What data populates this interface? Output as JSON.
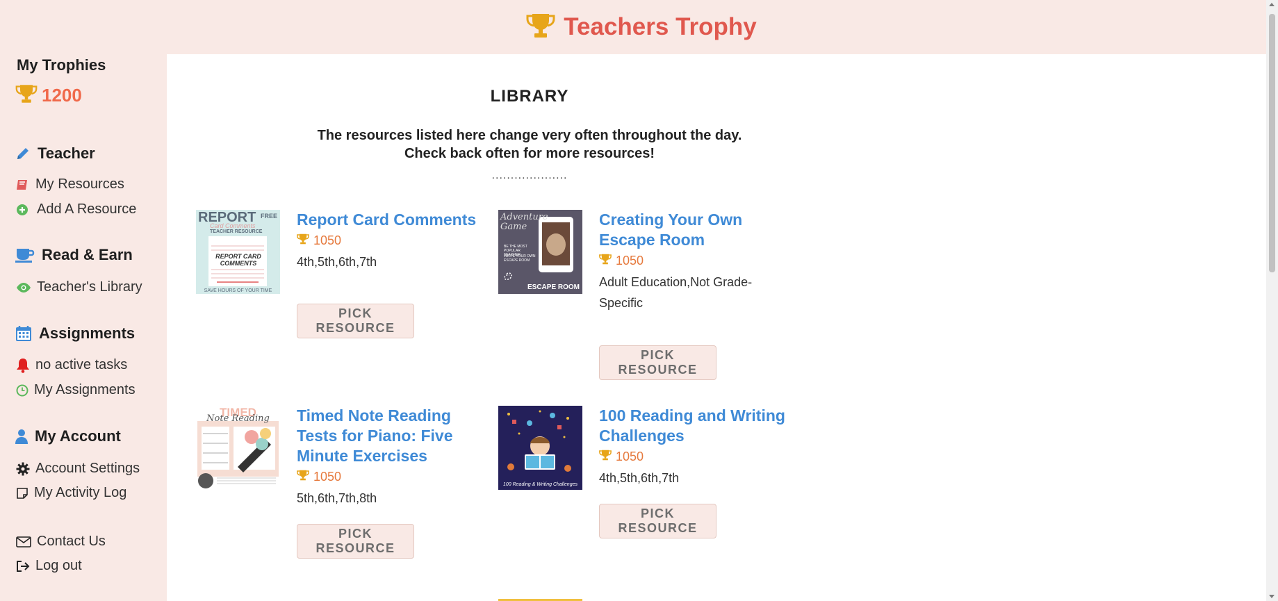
{
  "header": {
    "title": "Teachers Trophy"
  },
  "sidebar": {
    "trophies_heading": "My Trophies",
    "trophies_count": "1200",
    "teacher": {
      "heading": "Teacher",
      "my_resources": "My Resources",
      "add_resource": "Add A Resource"
    },
    "read_earn": {
      "heading": "Read & Earn",
      "library": "Teacher's Library"
    },
    "assignments": {
      "heading": "Assignments",
      "no_tasks": "no active tasks",
      "my_assignments": "My Assignments"
    },
    "account": {
      "heading": "My Account",
      "settings": "Account Settings",
      "activity_log": "My Activity Log"
    },
    "contact": "Contact Us",
    "logout": "Log out"
  },
  "library": {
    "title": "LIBRARY",
    "desc_line1": "The resources listed here change very often throughout the day.",
    "desc_line2": "Check back often for more resources!",
    "dots": "....................",
    "pick_label": "PICK RESOURCE",
    "resources": [
      {
        "title": "Report Card Comments",
        "price": "1050",
        "grades": "4th,5th,6th,7th",
        "thumb_text": {
          "top": "REPORT",
          "sub": "Card Comments",
          "badge": "FREE",
          "kind": "TEACHER RESOURCE",
          "handwritten": "REPORT CARD COMMENTS",
          "footer": "SAVE HOURS OF YOUR TIME"
        }
      },
      {
        "title": "Creating Your Own Escape Room",
        "price": "1050",
        "grades": "Adult Education,Not Grade-Specific",
        "thumb_text": {
          "script": "Adventure Game",
          "line1": "BE THE MOST POPULAR TEACHER",
          "line2": "WRITE YOUR OWN ESCAPE ROOM",
          "footer": "ESCAPE ROOM"
        }
      },
      {
        "title": "Timed Note Reading Tests for Piano: Five Minute Exercises",
        "price": "1050",
        "grades": "5th,6th,7th,8th",
        "thumb_text": {
          "top": "TIMED",
          "script": "Note Reading"
        }
      },
      {
        "title": "100 Reading and Writing Challenges",
        "price": "1050",
        "grades": "4th,5th,6th,7th",
        "thumb_text": {
          "footer": "100 Reading & Writing Challenges"
        }
      }
    ]
  },
  "colors": {
    "accent": "#e0584e",
    "link": "#3f8ad6",
    "price": "#e67a3e",
    "sidebar_bg": "#f9e9e5"
  }
}
